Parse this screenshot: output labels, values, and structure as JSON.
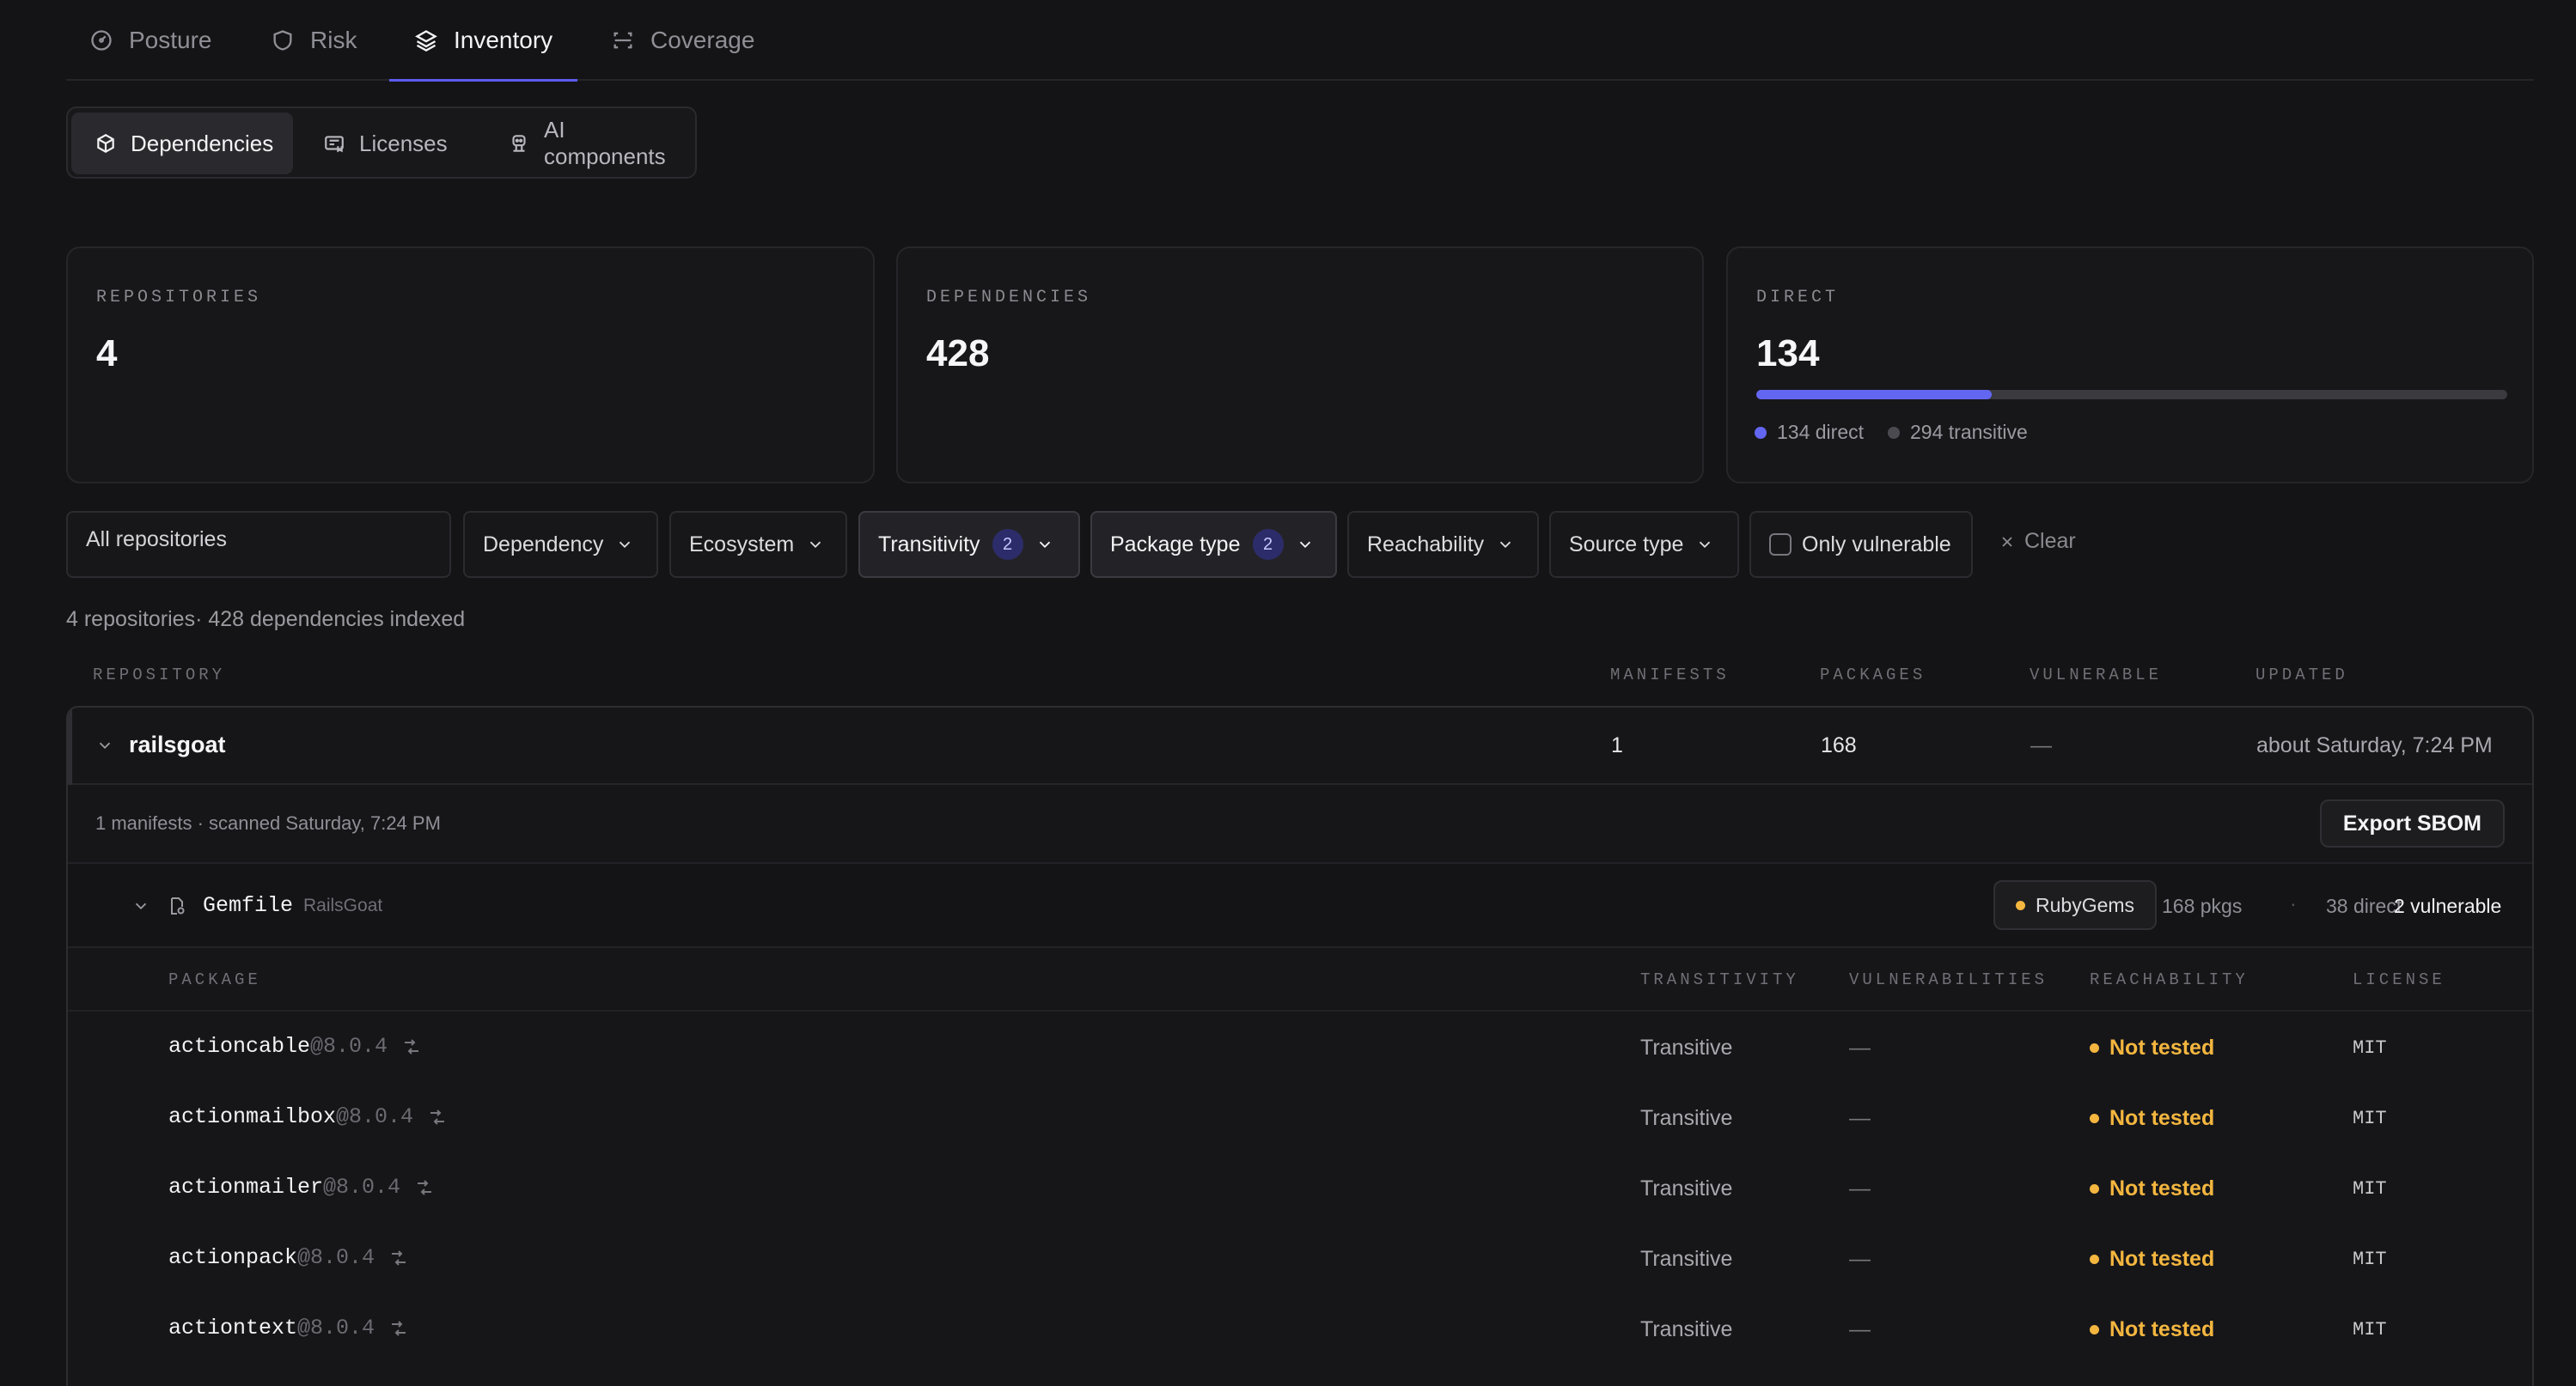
{
  "top_tabs": [
    {
      "label": "Posture",
      "icon": "gauge-icon"
    },
    {
      "label": "Risk",
      "icon": "shield-icon"
    },
    {
      "label": "Inventory",
      "icon": "layers-icon",
      "active": true
    },
    {
      "label": "Coverage",
      "icon": "scan-icon"
    }
  ],
  "sub_tabs": [
    {
      "label": "Dependencies",
      "icon": "box-icon",
      "active": true
    },
    {
      "label": "Licenses",
      "icon": "license-icon"
    },
    {
      "label": "AI components",
      "icon": "robot-icon"
    }
  ],
  "stats": {
    "repositories": {
      "label": "REPOSITORIES",
      "value": "4"
    },
    "dependencies": {
      "label": "DEPENDENCIES",
      "value": "428"
    },
    "direct": {
      "label": "DIRECT",
      "value": "134",
      "direct_fraction": 0.313,
      "legend_direct": "134 direct",
      "legend_transitive": "294 transitive"
    }
  },
  "filters": {
    "repo_select": "All repositories",
    "dependency": "Dependency",
    "ecosystem": "Ecosystem",
    "transitivity": "Transitivity",
    "transitivity_count": "2",
    "package_type": "Package type",
    "package_type_count": "2",
    "reachability": "Reachability",
    "source_type": "Source type",
    "only_vulnerable": "Only vulnerable",
    "clear": "Clear"
  },
  "summary": "4 repositories· 428 dependencies indexed",
  "columns": {
    "repository": "REPOSITORY",
    "manifests": "MANIFESTS",
    "packages": "PACKAGES",
    "vulnerable": "VULNERABLE",
    "updated": "UPDATED"
  },
  "repo": {
    "name": "railsgoat",
    "manifests": "1",
    "packages": "168",
    "vulnerable": "—",
    "updated": "about Saturday, 7:24 PM",
    "scan_info": "1 manifests · scanned Saturday, 7:24 PM",
    "export_label": "Export SBOM"
  },
  "manifest": {
    "file": "Gemfile",
    "project": "RailsGoat",
    "ecosystem": "RubyGems",
    "pkgs": "168 pkgs",
    "direct": "38 direct",
    "vulnerable": "2 vulnerable"
  },
  "package_columns": {
    "package": "PACKAGE",
    "transitivity": "TRANSITIVITY",
    "vulnerabilities": "VULNERABILITIES",
    "reachability": "REACHABILITY",
    "license": "LICENSE"
  },
  "packages": [
    {
      "name": "actioncable",
      "version": "@8.0.4",
      "transitivity": "Transitive",
      "vulns": "—",
      "reachability": "Not tested",
      "license": "MIT"
    },
    {
      "name": "actionmailbox",
      "version": "@8.0.4",
      "transitivity": "Transitive",
      "vulns": "—",
      "reachability": "Not tested",
      "license": "MIT"
    },
    {
      "name": "actionmailer",
      "version": "@8.0.4",
      "transitivity": "Transitive",
      "vulns": "—",
      "reachability": "Not tested",
      "license": "MIT"
    },
    {
      "name": "actionpack",
      "version": "@8.0.4",
      "transitivity": "Transitive",
      "vulns": "—",
      "reachability": "Not tested",
      "license": "MIT"
    },
    {
      "name": "actiontext",
      "version": "@8.0.4",
      "transitivity": "Transitive",
      "vulns": "—",
      "reachability": "Not tested",
      "license": "MIT"
    }
  ],
  "colors": {
    "accent": "#6366f1",
    "warning": "#f4b63f",
    "transitive_dot": "#4a4a50"
  }
}
